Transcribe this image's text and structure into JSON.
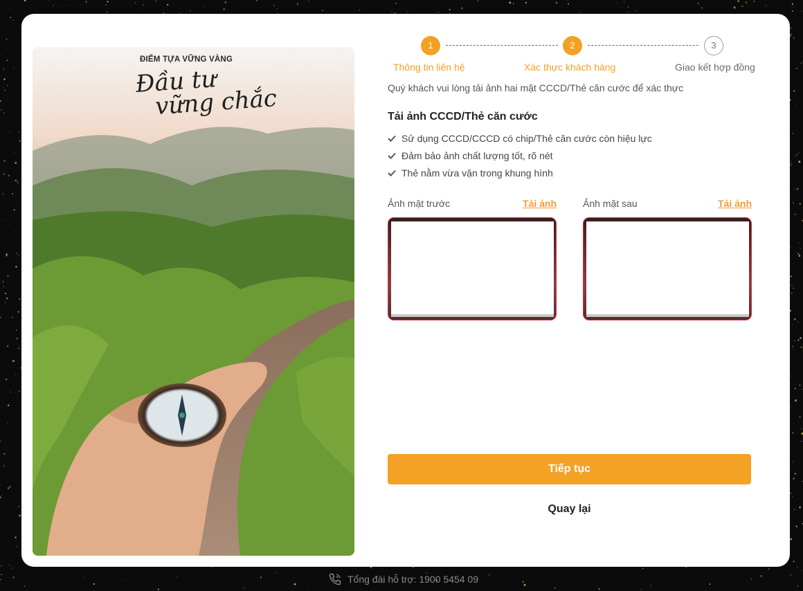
{
  "hero": {
    "kicker": "ĐIỂM TỰA VỮNG VÀNG",
    "script_line1": "Đầu tư",
    "script_line2": "vững chắc"
  },
  "stepper": {
    "steps": [
      {
        "number": "1",
        "label": "Thông tin liên hệ",
        "state": "active"
      },
      {
        "number": "2",
        "label": "Xác thực khách hàng",
        "state": "active"
      },
      {
        "number": "3",
        "label": "Giao kết hợp đồng",
        "state": "inactive"
      }
    ]
  },
  "main": {
    "instruction": "Quý khách vui lòng tải ảnh hai mặt CCCD/Thẻ căn cước để xác thực",
    "section_title": "Tải ảnh CCCD/Thẻ căn cước",
    "checklist": [
      "Sử dụng CCCD/CCCD có chip/Thẻ căn cước còn hiệu lực",
      "Đảm bảo ảnh chất lượng tốt, rõ nét",
      "Thẻ nằm vừa vặn trong khung hình"
    ],
    "front": {
      "label": "Ảnh mặt trước",
      "upload_link": "Tải ảnh"
    },
    "back": {
      "label": "Ảnh mặt sau",
      "upload_link": "Tải ảnh"
    },
    "continue_label": "Tiếp tục",
    "back_label": "Quay lại"
  },
  "footer": {
    "hotline": "Tổng đài hỗ trợ: 1900 5454 09",
    "icon": "phone-icon"
  },
  "colors": {
    "accent": "#f4a024",
    "upload_border": "#d13045",
    "link": "#f39c3a"
  }
}
